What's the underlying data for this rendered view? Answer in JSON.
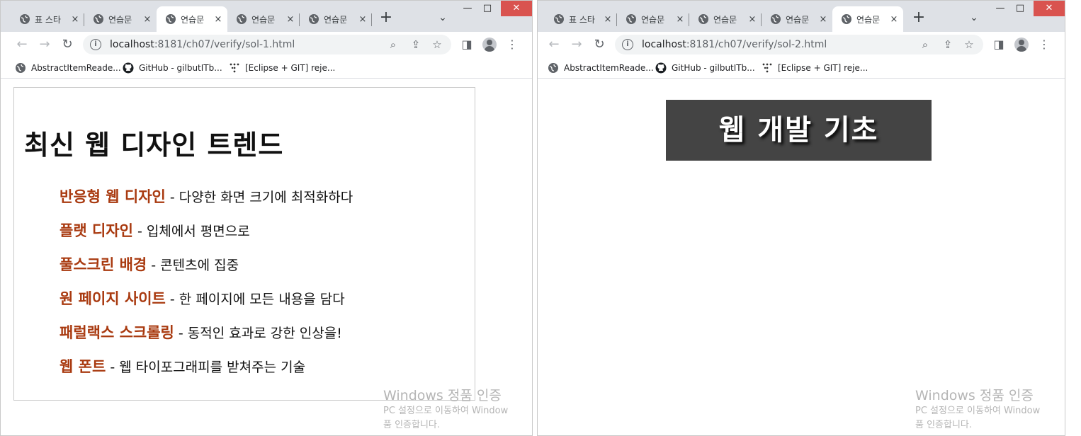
{
  "colors": {
    "chrome_frame": "#dee1e6",
    "close_button": "#d9534f",
    "trend_name": "#a93a10",
    "banner_bg": "#444444",
    "watermark": "#b5b5b5"
  },
  "windows": [
    {
      "tabs": [
        {
          "label": "표 스타",
          "active": false,
          "close": "×"
        },
        {
          "label": "연습문",
          "active": false,
          "close": "×"
        },
        {
          "label": "연습문",
          "active": true,
          "close": "×"
        },
        {
          "label": "연습문",
          "active": false,
          "close": "×"
        },
        {
          "label": "연습문",
          "active": false,
          "close": "×"
        }
      ],
      "new_tab": "+",
      "tab_search": "⌄",
      "controls": {
        "minimize": "—",
        "maximize": "□",
        "close": "✕"
      },
      "toolbar": {
        "back": "←",
        "forward": "→",
        "reload": "↻",
        "url_host": "localhost",
        "url_rest": ":8181/ch07/verify/sol-1.html"
      },
      "bookmarks": [
        {
          "label": "AbstractItemReade...",
          "icon": "globe-icon"
        },
        {
          "label": "GitHub - gilbutITb...",
          "icon": "github-icon"
        },
        {
          "label": "[Eclipse + GIT] reje...",
          "icon": "dots-icon"
        }
      ],
      "page": {
        "heading": "최신 웹 디자인 트렌드",
        "trends": [
          {
            "name": "반응형 웹 디자인",
            "desc": " - 다양한 화면 크기에 최적화하다"
          },
          {
            "name": "플랫 디자인",
            "desc": " - 입체에서 평면으로"
          },
          {
            "name": "풀스크린 배경",
            "desc": " - 콘텐츠에 집중"
          },
          {
            "name": "원 페이지 사이트",
            "desc": " - 한 페이지에 모든 내용을 담다"
          },
          {
            "name": "패럴랙스 스크롤링",
            "desc": " - 동적인 효과로 강한 인상을!"
          },
          {
            "name": "웹 폰트",
            "desc": " - 웹 타이포그래피를 받쳐주는 기술"
          }
        ]
      },
      "watermark": {
        "title": "Windows 정품 인증",
        "line1": "PC 설정으로 이동하여 Window",
        "line2": "품 인증합니다."
      }
    },
    {
      "tabs": [
        {
          "label": "표 스타",
          "active": false,
          "close": "×"
        },
        {
          "label": "연습문",
          "active": false,
          "close": "×"
        },
        {
          "label": "연습문",
          "active": false,
          "close": "×"
        },
        {
          "label": "연습문",
          "active": false,
          "close": "×"
        },
        {
          "label": "연습문",
          "active": true,
          "close": "×"
        }
      ],
      "new_tab": "+",
      "tab_search": "⌄",
      "controls": {
        "minimize": "—",
        "maximize": "□",
        "close": "✕"
      },
      "toolbar": {
        "back": "←",
        "forward": "→",
        "reload": "↻",
        "url_host": "localhost",
        "url_rest": ":8181/ch07/verify/sol-2.html"
      },
      "bookmarks": [
        {
          "label": "AbstractItemReade...",
          "icon": "globe-icon"
        },
        {
          "label": "GitHub - gilbutITb...",
          "icon": "github-icon"
        },
        {
          "label": "[Eclipse + GIT] reje...",
          "icon": "dots-icon"
        }
      ],
      "page": {
        "banner": "웹 개발 기초"
      },
      "watermark": {
        "title": "Windows 정품 인증",
        "line1": "PC 설정으로 이동하여 Window",
        "line2": "품 인증합니다."
      }
    }
  ]
}
